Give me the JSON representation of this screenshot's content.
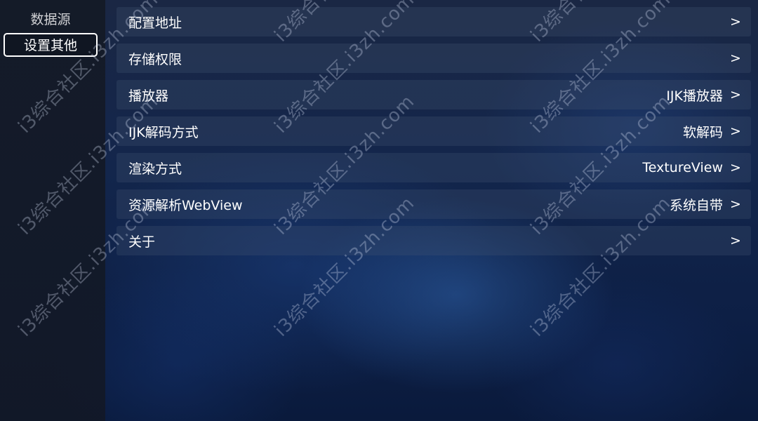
{
  "sidebar": {
    "items": [
      {
        "label": "数据源"
      },
      {
        "label": "设置其他"
      }
    ]
  },
  "settings": {
    "rows": [
      {
        "label": "配置地址",
        "value": "",
        "chevron": ">"
      },
      {
        "label": "存储权限",
        "value": "",
        "chevron": ">"
      },
      {
        "label": "播放器",
        "value": "IJK播放器",
        "chevron": ">"
      },
      {
        "label": "IJK解码方式",
        "value": "软解码",
        "chevron": ">"
      },
      {
        "label": "渲染方式",
        "value": "TextureView",
        "chevron": ">"
      },
      {
        "label": "资源解析WebView",
        "value": "系统自带",
        "chevron": ">"
      },
      {
        "label": "关于",
        "value": "",
        "chevron": ">"
      }
    ]
  },
  "watermark": {
    "text": "i3综合社区.i3zh.com"
  }
}
